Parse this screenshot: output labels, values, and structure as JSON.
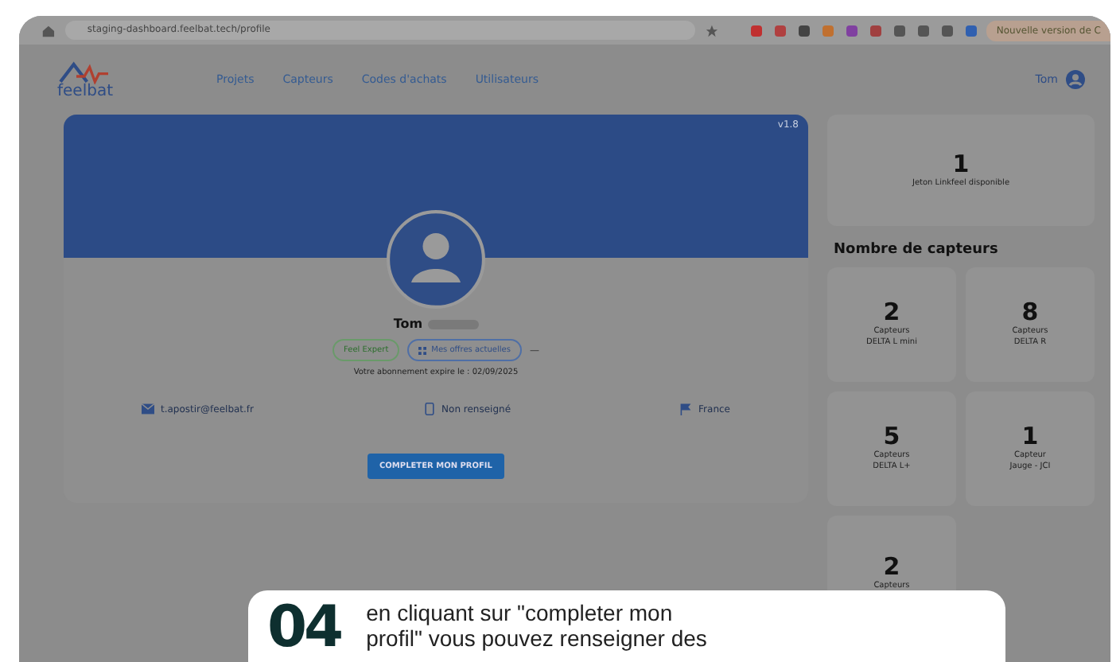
{
  "browser": {
    "url": "staging-dashboard.feelbat.tech/profile",
    "update_notice": "Nouvelle version de C"
  },
  "header": {
    "logo": "feelbat",
    "nav": [
      {
        "label": "Projets"
      },
      {
        "label": "Capteurs"
      },
      {
        "label": "Codes d'achats"
      },
      {
        "label": "Utilisateurs"
      }
    ],
    "user": "Tom"
  },
  "profile": {
    "version": "v1.8",
    "name": "Tom",
    "badges": [
      {
        "label": "Feel Expert",
        "kind": "level"
      },
      {
        "label": "Mes offres actuelles",
        "kind": "offers"
      }
    ],
    "more": "—",
    "expiry": "Votre abonnement expire le : 02/09/2025",
    "contacts": [
      {
        "kind": "email",
        "text": "t.apostir@feelbat.fr"
      },
      {
        "kind": "phone",
        "text": "Non renseigné"
      },
      {
        "kind": "country",
        "text": "France"
      }
    ],
    "button": "COMPLETER MON PROFIL"
  },
  "tokens": {
    "count": "1",
    "label": "Jeton Linkfeel disponible"
  },
  "sensors": {
    "title": "Nombre de capteurs",
    "items": [
      {
        "count": "2",
        "label": "Capteurs",
        "model": "DELTA L mini"
      },
      {
        "count": "8",
        "label": "Capteurs",
        "model": "DELTA R"
      },
      {
        "count": "5",
        "label": "Capteurs",
        "model": "DELTA L+"
      },
      {
        "count": "1",
        "label": "Capteur",
        "model": "Jauge - JCI"
      },
      {
        "count": "2",
        "label": "Capteurs"
      }
    ]
  },
  "callout": {
    "step": "04",
    "lines": [
      "en cliquant sur \"completer mon",
      "profil\" vous pouvez renseigner des"
    ]
  }
}
